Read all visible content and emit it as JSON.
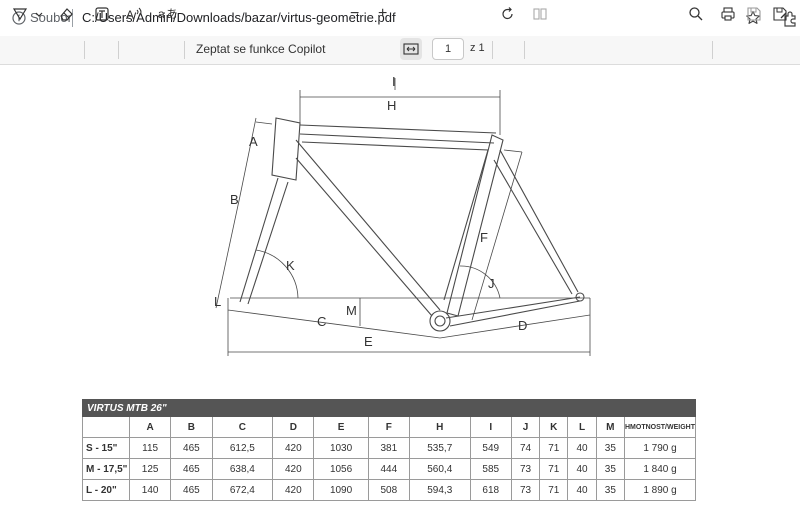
{
  "browser": {
    "site_label": "Soubor",
    "url": "C:/Users/Admin/Downloads/bazar/virtus-geometrie.pdf"
  },
  "pdf_toolbar": {
    "ask_copilot": "Zeptat se funkce Copilot",
    "zoom_out": "−",
    "zoom_in": "+",
    "current_page": "1",
    "page_total": "z 1"
  },
  "diagram": {
    "labels": [
      "H",
      "I",
      "A",
      "B",
      "K",
      "L",
      "M",
      "C",
      "E",
      "F",
      "J",
      "D"
    ]
  },
  "table": {
    "title": "VIRTUS MTB 26\"",
    "columns": [
      "",
      "A",
      "B",
      "C",
      "D",
      "E",
      "F",
      "H",
      "I",
      "J",
      "K",
      "L",
      "M",
      "HMOTNOST/WEIGHT"
    ],
    "rows": [
      [
        "S - 15\"",
        "115",
        "465",
        "612,5",
        "420",
        "1030",
        "381",
        "535,7",
        "549",
        "74",
        "71",
        "40",
        "35",
        "1 790 g"
      ],
      [
        "M - 17,5\"",
        "125",
        "465",
        "638,4",
        "420",
        "1056",
        "444",
        "560,4",
        "585",
        "73",
        "71",
        "40",
        "35",
        "1 840 g"
      ],
      [
        "L - 20\"",
        "140",
        "465",
        "672,4",
        "420",
        "1090",
        "508",
        "594,3",
        "618",
        "73",
        "71",
        "40",
        "35",
        "1 890 g"
      ]
    ]
  }
}
